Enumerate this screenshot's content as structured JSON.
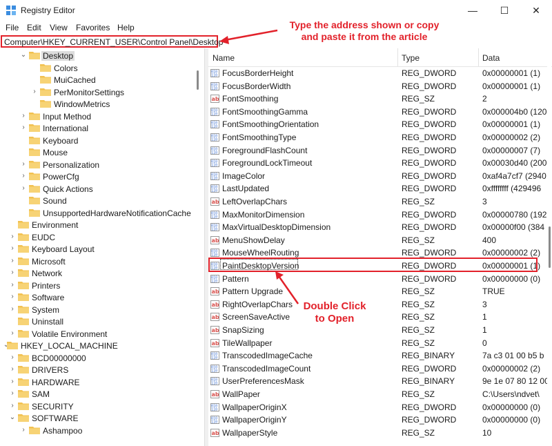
{
  "window": {
    "title": "Registry Editor",
    "minimize": "—",
    "maximize": "☐",
    "close": "✕"
  },
  "menu": [
    "File",
    "Edit",
    "View",
    "Favorites",
    "Help"
  ],
  "address": "Computer\\HKEY_CURRENT_USER\\Control Panel\\Desktop",
  "annotations": {
    "address_note_line1": "Type the address shown or copy",
    "address_note_line2": "and paste it from the article",
    "double_click_line1": "Double Click",
    "double_click_line2": "to Open"
  },
  "colors": {
    "accent": "#e2212a",
    "folder": "#f2c150",
    "reg_sz_icon": "#d9534f",
    "dword_icon": "#3b6fd1"
  },
  "tree": [
    {
      "label": "Desktop",
      "level": 2,
      "chevron": "down",
      "selected": true
    },
    {
      "label": "Colors",
      "level": 3,
      "chevron": "none"
    },
    {
      "label": "MuiCached",
      "level": 3,
      "chevron": "none"
    },
    {
      "label": "PerMonitorSettings",
      "level": 3,
      "chevron": "right"
    },
    {
      "label": "WindowMetrics",
      "level": 3,
      "chevron": "none"
    },
    {
      "label": "Input Method",
      "level": 2,
      "chevron": "right"
    },
    {
      "label": "International",
      "level": 2,
      "chevron": "right"
    },
    {
      "label": "Keyboard",
      "level": 2,
      "chevron": "none"
    },
    {
      "label": "Mouse",
      "level": 2,
      "chevron": "none"
    },
    {
      "label": "Personalization",
      "level": 2,
      "chevron": "right"
    },
    {
      "label": "PowerCfg",
      "level": 2,
      "chevron": "right"
    },
    {
      "label": "Quick Actions",
      "level": 2,
      "chevron": "right"
    },
    {
      "label": "Sound",
      "level": 2,
      "chevron": "none"
    },
    {
      "label": "UnsupportedHardwareNotificationCache",
      "level": 2,
      "chevron": "none"
    },
    {
      "label": "Environment",
      "level": 1,
      "chevron": "none"
    },
    {
      "label": "EUDC",
      "level": 1,
      "chevron": "right"
    },
    {
      "label": "Keyboard Layout",
      "level": 1,
      "chevron": "right"
    },
    {
      "label": "Microsoft",
      "level": 1,
      "chevron": "right"
    },
    {
      "label": "Network",
      "level": 1,
      "chevron": "right"
    },
    {
      "label": "Printers",
      "level": 1,
      "chevron": "right"
    },
    {
      "label": "Software",
      "level": 1,
      "chevron": "right"
    },
    {
      "label": "System",
      "level": 1,
      "chevron": "right"
    },
    {
      "label": "Uninstall",
      "level": 1,
      "chevron": "none"
    },
    {
      "label": "Volatile Environment",
      "level": 1,
      "chevron": "right"
    },
    {
      "label": "HKEY_LOCAL_MACHINE",
      "level": 0,
      "chevron": "down"
    },
    {
      "label": "BCD00000000",
      "level": 1,
      "chevron": "right"
    },
    {
      "label": "DRIVERS",
      "level": 1,
      "chevron": "right"
    },
    {
      "label": "HARDWARE",
      "level": 1,
      "chevron": "right"
    },
    {
      "label": "SAM",
      "level": 1,
      "chevron": "right"
    },
    {
      "label": "SECURITY",
      "level": 1,
      "chevron": "right"
    },
    {
      "label": "SOFTWARE",
      "level": 1,
      "chevron": "down"
    },
    {
      "label": "Ashampoo",
      "level": 2,
      "chevron": "right"
    }
  ],
  "list": {
    "columns": [
      "Name",
      "Type",
      "Data"
    ],
    "rows": [
      {
        "name": "FocusBorderHeight",
        "type": "REG_DWORD",
        "data": "0x00000001 (1)"
      },
      {
        "name": "FocusBorderWidth",
        "type": "REG_DWORD",
        "data": "0x00000001 (1)"
      },
      {
        "name": "FontSmoothing",
        "type": "REG_SZ",
        "data": "2"
      },
      {
        "name": "FontSmoothingGamma",
        "type": "REG_DWORD",
        "data": "0x000004b0 (120"
      },
      {
        "name": "FontSmoothingOrientation",
        "type": "REG_DWORD",
        "data": "0x00000001 (1)"
      },
      {
        "name": "FontSmoothingType",
        "type": "REG_DWORD",
        "data": "0x00000002 (2)"
      },
      {
        "name": "ForegroundFlashCount",
        "type": "REG_DWORD",
        "data": "0x00000007 (7)"
      },
      {
        "name": "ForegroundLockTimeout",
        "type": "REG_DWORD",
        "data": "0x00030d40 (200"
      },
      {
        "name": "ImageColor",
        "type": "REG_DWORD",
        "data": "0xaf4a7cf7 (2940"
      },
      {
        "name": "LastUpdated",
        "type": "REG_DWORD",
        "data": "0xffffffff (429496"
      },
      {
        "name": "LeftOverlapChars",
        "type": "REG_SZ",
        "data": "3"
      },
      {
        "name": "MaxMonitorDimension",
        "type": "REG_DWORD",
        "data": "0x00000780 (192"
      },
      {
        "name": "MaxVirtualDesktopDimension",
        "type": "REG_DWORD",
        "data": "0x00000f00 (384"
      },
      {
        "name": "MenuShowDelay",
        "type": "REG_SZ",
        "data": "400"
      },
      {
        "name": "MouseWheelRouting",
        "type": "REG_DWORD",
        "data": "0x00000002 (2)"
      },
      {
        "name": "PaintDesktopVersion",
        "type": "REG_DWORD",
        "data": "0x00000001 (1)",
        "highlight": true
      },
      {
        "name": "Pattern",
        "type": "REG_DWORD",
        "data": "0x00000000 (0)"
      },
      {
        "name": "Pattern Upgrade",
        "type": "REG_SZ",
        "data": "TRUE"
      },
      {
        "name": "RightOverlapChars",
        "type": "REG_SZ",
        "data": "3"
      },
      {
        "name": "ScreenSaveActive",
        "type": "REG_SZ",
        "data": "1"
      },
      {
        "name": "SnapSizing",
        "type": "REG_SZ",
        "data": "1"
      },
      {
        "name": "TileWallpaper",
        "type": "REG_SZ",
        "data": "0"
      },
      {
        "name": "TranscodedImageCache",
        "type": "REG_BINARY",
        "data": "7a c3 01 00 b5 b"
      },
      {
        "name": "TranscodedImageCount",
        "type": "REG_DWORD",
        "data": "0x00000002 (2)"
      },
      {
        "name": "UserPreferencesMask",
        "type": "REG_BINARY",
        "data": "9e 1e 07 80 12 00"
      },
      {
        "name": "WallPaper",
        "type": "REG_SZ",
        "data": "C:\\Users\\ndvet\\"
      },
      {
        "name": "WallpaperOriginX",
        "type": "REG_DWORD",
        "data": "0x00000000 (0)"
      },
      {
        "name": "WallpaperOriginY",
        "type": "REG_DWORD",
        "data": "0x00000000 (0)"
      },
      {
        "name": "WallpaperStyle",
        "type": "REG_SZ",
        "data": "10"
      }
    ]
  }
}
